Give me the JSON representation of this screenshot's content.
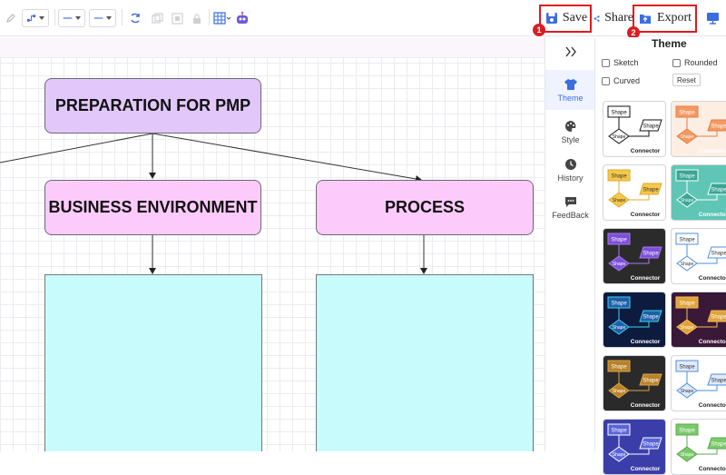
{
  "toolbar": {
    "save_label": "Save",
    "share_label": "Share",
    "export_label": "Export",
    "badge_1": "1",
    "badge_2": "2",
    "accent": "#3b6ce0",
    "highlight_color": "#e0191f"
  },
  "diagram": {
    "root": "PREPARATION FOR PMP",
    "child_1": "BUSINESS ENVIRONMENT",
    "child_2": "PROCESS"
  },
  "sidenav": {
    "items": [
      {
        "label": "Theme",
        "icon": "shirt-icon",
        "active": true
      },
      {
        "label": "Style",
        "icon": "palette-icon",
        "active": false
      },
      {
        "label": "History",
        "icon": "clock-icon",
        "active": false
      },
      {
        "label": "FeedBack",
        "icon": "feedback-icon",
        "active": false
      }
    ]
  },
  "panel": {
    "title": "Theme",
    "options": {
      "sketch": "Sketch",
      "rounded": "Rounded",
      "curved": "Curved",
      "reset": "Reset"
    },
    "thumb": {
      "shape": "Shape",
      "connector": "Connector"
    },
    "themes": [
      {
        "bg": "#ffffff",
        "box": "#ffffff",
        "stroke": "#111111",
        "text": "#111111"
      },
      {
        "bg": "#fdeee4",
        "box": "#f29a63",
        "stroke": "#e57f45",
        "text": "#ffffff"
      },
      {
        "bg": "#ffffff",
        "box": "#f6c84a",
        "stroke": "#e0a92d",
        "text": "#333333"
      },
      {
        "bg": "#5fc6b5",
        "box": "#3aa697",
        "stroke": "#ffffff",
        "text": "#ffffff"
      },
      {
        "bg": "#2b2b2b",
        "box": "#7c4fd8",
        "stroke": "#a57bf0",
        "text": "#ffffff"
      },
      {
        "bg": "#ffffff",
        "box": "#ffffff",
        "stroke": "#4b8fe0",
        "text": "#333333"
      },
      {
        "bg": "#0d1b3e",
        "box": "#1f5fa8",
        "stroke": "#3fd3ee",
        "text": "#ffffff"
      },
      {
        "bg": "#3a1838",
        "box": "#e0a23c",
        "stroke": "#f1c153",
        "text": "#ffffff"
      },
      {
        "bg": "#2a2a2a",
        "box": "#b9822a",
        "stroke": "#d9a64a",
        "text": "#ffffff"
      },
      {
        "bg": "#ffffff",
        "box": "#dfeafb",
        "stroke": "#4b8fe0",
        "text": "#333333"
      },
      {
        "bg": "#3b3ea8",
        "box": "#5a64d8",
        "stroke": "#ffffff",
        "text": "#ffffff"
      },
      {
        "bg": "#ffffff",
        "box": "#7bc96b",
        "stroke": "#5aa94c",
        "text": "#ffffff"
      }
    ]
  }
}
